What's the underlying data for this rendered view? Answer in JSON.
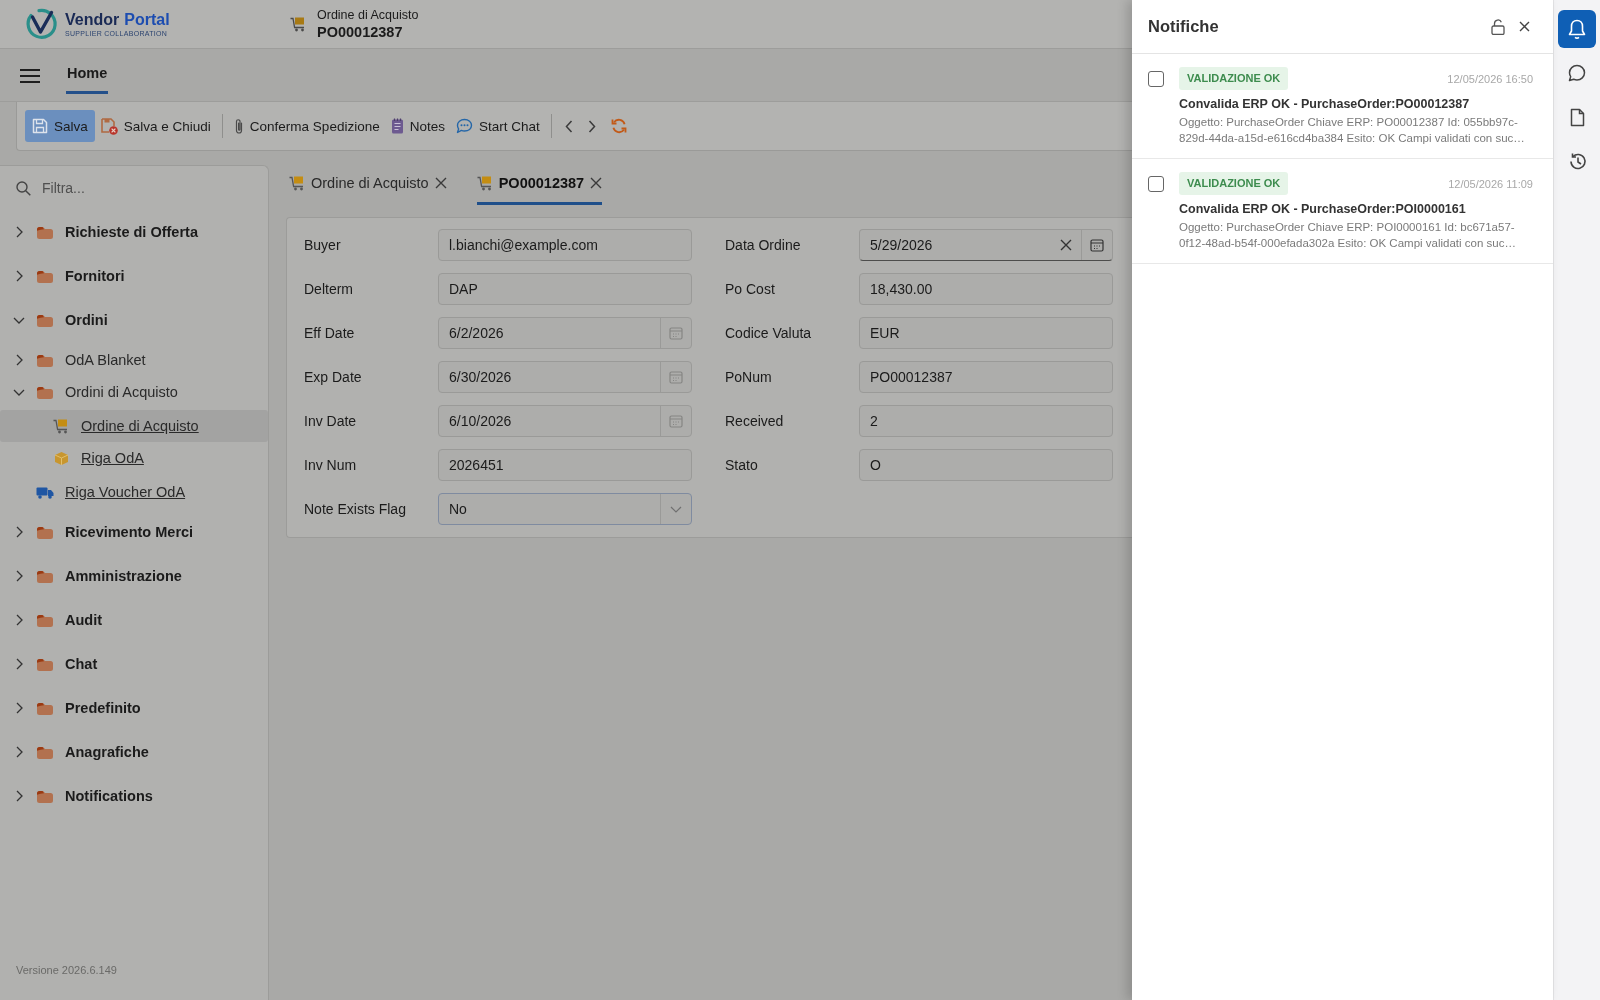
{
  "header": {
    "logo": {
      "words": [
        "Vendor",
        "Portal"
      ],
      "tagline": "SUPPLIER COLLABORATION"
    },
    "document": {
      "type": "Ordine di Acquisto",
      "number": "PO00012387"
    }
  },
  "nav_tabs": [
    {
      "label": "Home",
      "selected": true
    }
  ],
  "toolbar": {
    "groups": [
      [
        {
          "kind": "primary",
          "label": "Salva"
        },
        {
          "kind": "plain",
          "label": "Salva e Chiudi"
        }
      ],
      [
        {
          "kind": "plain",
          "label": "Conferma Spedizione"
        },
        {
          "kind": "plain",
          "label": "Notes"
        },
        {
          "kind": "plain",
          "label": "Start Chat"
        }
      ],
      [
        {
          "kind": "icon"
        },
        {
          "kind": "icon"
        },
        {
          "kind": "icon"
        }
      ]
    ]
  },
  "sidebar": {
    "filter": {
      "placeholder": "Filtra..."
    },
    "tree": [
      {
        "kind": "folder",
        "label": "Richieste di Offerta",
        "expanded": false,
        "selected": false
      },
      {
        "kind": "folder",
        "label": "Fornitori",
        "expanded": false,
        "selected": false
      },
      {
        "kind": "folder",
        "label": "Ordini",
        "expanded": true,
        "selected": false,
        "children": [
          {
            "kind": "folder",
            "label": "OdA Blanket",
            "expanded": false,
            "selected": false
          },
          {
            "kind": "folder",
            "label": "Ordini di Acquisto",
            "expanded": true,
            "selected": false,
            "children": [
              {
                "kind": "order",
                "label": "Ordine di Acquisto",
                "selected": true
              },
              {
                "kind": "order_line",
                "label": "Riga OdA",
                "selected": false
              }
            ]
          },
          {
            "kind": "voucher_line",
            "label": "Riga Voucher OdA",
            "selected": false
          }
        ]
      },
      {
        "kind": "folder",
        "label": "Ricevimento Merci",
        "expanded": false,
        "selected": false
      },
      {
        "kind": "folder",
        "label": "Amministrazione",
        "expanded": false,
        "selected": false
      },
      {
        "kind": "folder",
        "label": "Audit",
        "expanded": false,
        "selected": false
      },
      {
        "kind": "folder",
        "label": "Chat",
        "expanded": false,
        "selected": false
      },
      {
        "kind": "folder",
        "label": "Predefinito",
        "expanded": false,
        "selected": false
      },
      {
        "kind": "folder",
        "label": "Anagrafiche",
        "expanded": false,
        "selected": false
      },
      {
        "kind": "folder",
        "label": "Notifications",
        "expanded": false,
        "selected": false
      }
    ],
    "version": "Versione 2026.6.149"
  },
  "document_tabs": [
    {
      "label": "Ordine di Acquisto",
      "selected": false
    },
    {
      "label": "PO00012387",
      "selected": true
    }
  ],
  "form": {
    "columns": [
      [
        {
          "label": "Buyer",
          "kind": "text",
          "value": "l.bianchi@example.com"
        },
        {
          "label": "Delterm",
          "kind": "text",
          "value": "DAP"
        },
        {
          "label": "Eff Date",
          "kind": "date",
          "value": "6/2/2026"
        },
        {
          "label": "Exp Date",
          "kind": "date",
          "value": "6/30/2026"
        },
        {
          "label": "Inv Date",
          "kind": "date",
          "value": "6/10/2026"
        },
        {
          "label": "Inv Num",
          "kind": "text",
          "value": "2026451"
        },
        {
          "label": "Note Exists Flag",
          "kind": "select",
          "value": "No"
        }
      ],
      [
        {
          "label": "Data Ordine",
          "kind": "date_clearable",
          "value": "5/29/2026"
        },
        {
          "label": "Po Cost",
          "kind": "text",
          "value": "18,430.00"
        },
        {
          "label": "Codice Valuta",
          "kind": "text",
          "value": "EUR"
        },
        {
          "label": "PoNum",
          "kind": "text",
          "value": "PO00012387"
        },
        {
          "label": "Received",
          "kind": "text",
          "value": "2"
        },
        {
          "label": "Stato",
          "kind": "text",
          "value": "O"
        }
      ]
    ]
  },
  "notifications_panel": {
    "title": "Notifiche",
    "items": [
      {
        "checked": false,
        "badge": "VALIDAZIONE OK",
        "time": "12/05/2026 16:50",
        "title": "Convalida ERP OK - PurchaseOrder:PO00012387",
        "body": "Oggetto: PurchaseOrder Chiave ERP: PO00012387 Id: 055bb97c-829d-44da-a15d-e616cd4ba384 Esito: OK Campi validati con suc…"
      },
      {
        "checked": false,
        "badge": "VALIDAZIONE OK",
        "time": "12/05/2026 11:09",
        "title": "Convalida ERP OK - PurchaseOrder:POI0000161",
        "body": "Oggetto: PurchaseOrder Chiave ERP: POI0000161 Id: bc671a57-0f12-48ad-b54f-000efada302a Esito: OK Campi validati con suc…"
      }
    ]
  },
  "side_rail": [
    {
      "selected": true
    },
    {
      "selected": false
    },
    {
      "selected": false
    },
    {
      "selected": false
    }
  ]
}
